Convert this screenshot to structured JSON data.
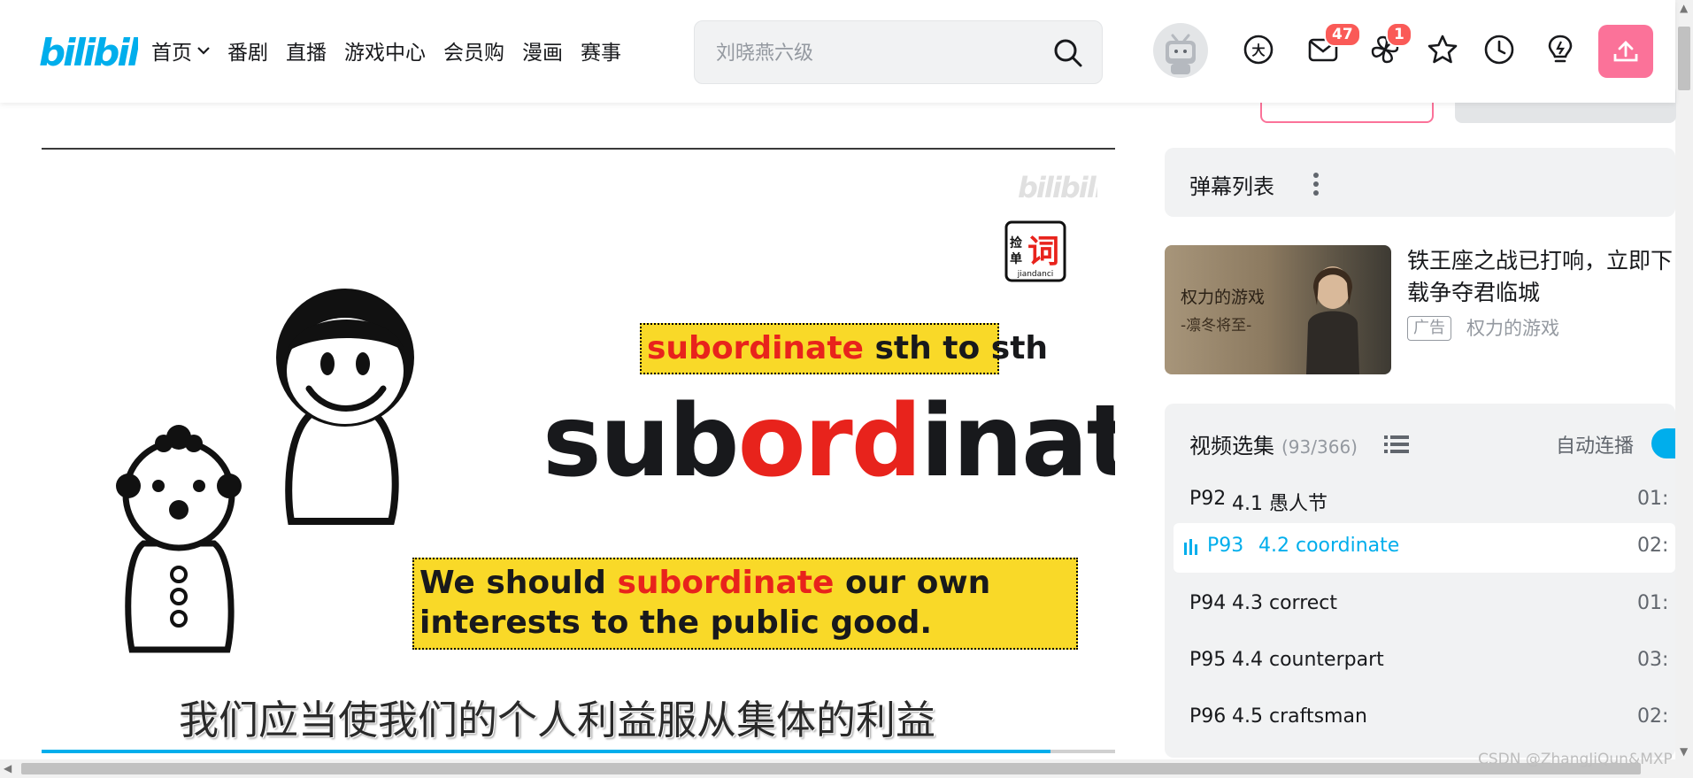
{
  "header": {
    "logo_text": "bilibili",
    "nav": [
      "首页",
      "番剧",
      "直播",
      "游戏中心",
      "会员购",
      "漫画",
      "赛事"
    ],
    "search_placeholder": "刘晓燕六级",
    "badges": {
      "messages": "47",
      "dynamics": "1"
    },
    "colors": {
      "brand": "#00aeec",
      "badge": "#fa5a57",
      "upload": "#fb7299"
    },
    "icons": [
      "big-member-icon",
      "message-icon",
      "dynamic-icon",
      "favorite-icon",
      "history-icon",
      "creation-icon",
      "upload-icon"
    ]
  },
  "player": {
    "watermark": "bilibili",
    "brand_logo": {
      "top": "捡",
      "bottom": "单",
      "main": "词",
      "caption": "jiandanci"
    },
    "phrase": {
      "highlight": "subordinate",
      "rest": " sth to sth"
    },
    "word": {
      "part1": "sub",
      "part2": "ord",
      "part3": "inate"
    },
    "sentence": {
      "before": "We should ",
      "highlight": "subordinate",
      "after": " our own interests to the public good."
    },
    "subtitle": "我们应当使我们的个人利益服从集体的利益",
    "progress": 0.94,
    "colors": {
      "highlight": "#e8231c",
      "card": "#f9d928",
      "progress": "#00aeec"
    }
  },
  "danmaku": {
    "title": "弹幕列表"
  },
  "ad": {
    "thumb_title": "权力的游戏",
    "thumb_sub": "-凛冬将至-",
    "title": "铁王座之战已打响，立即下载争夺君临城",
    "tag": "广告",
    "source": "权力的游戏"
  },
  "episodes": {
    "title": "视频选集",
    "count": "(93/366)",
    "autoplay_label": "自动连播",
    "items": [
      {
        "num": "P92",
        "name": "4.1 愚人节",
        "duration": "01:"
      },
      {
        "num": "P93",
        "name": "4.2 coordinate",
        "duration": "02:",
        "active": true
      },
      {
        "num": "P94",
        "name": "4.3 correct",
        "duration": "01:"
      },
      {
        "num": "P95",
        "name": "4.4 counterpart",
        "duration": "03:"
      },
      {
        "num": "P96",
        "name": "4.5 craftsman",
        "duration": "02:"
      }
    ]
  },
  "watermark_text": "CSDN @ZhangJiQun&MXP"
}
